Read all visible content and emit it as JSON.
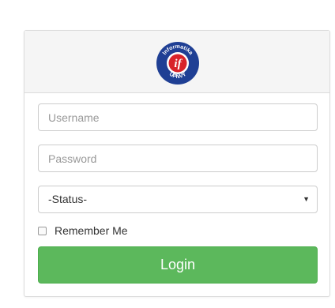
{
  "logo": {
    "text_top": "Informatika",
    "text_bottom": "UPNVY",
    "monogram": "if",
    "colors": {
      "ring": "#1f3f94",
      "badge": "#d8232a",
      "text": "#ffffff"
    }
  },
  "form": {
    "username": {
      "placeholder": "Username",
      "value": ""
    },
    "password": {
      "placeholder": "Password",
      "value": ""
    },
    "status": {
      "selected": "-Status-",
      "caret": "▼"
    },
    "remember": {
      "label": "Remember Me",
      "checked": false
    },
    "login_label": "Login"
  },
  "colors": {
    "accent": "#5cb85c",
    "panel_header": "#f5f5f5",
    "border": "#dcdcdc"
  }
}
